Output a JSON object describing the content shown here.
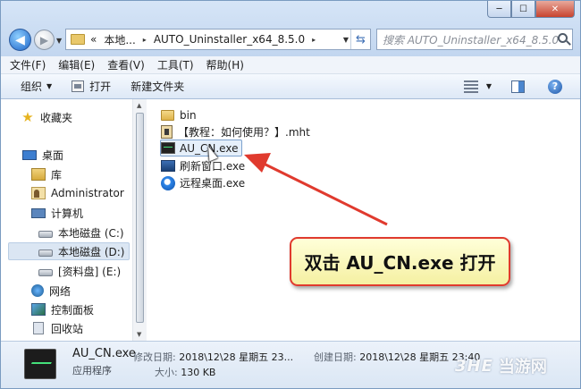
{
  "window": {
    "caption_min": "─",
    "caption_max": "☐",
    "caption_close": "✕"
  },
  "address": {
    "chevron": "«",
    "parts": [
      "本地...",
      "AUTO_Uninstaller_x64_8.5.0"
    ],
    "separator": "▸"
  },
  "search": {
    "placeholder": "搜索 AUTO_Uninstaller_x64_8.5.0"
  },
  "menu": [
    "文件(F)",
    "编辑(E)",
    "查看(V)",
    "工具(T)",
    "帮助(H)"
  ],
  "toolbar": {
    "organize": "组织",
    "open": "打开",
    "new_folder": "新建文件夹",
    "help": "?"
  },
  "nav": {
    "favorites": "收藏夹",
    "desktop": "桌面",
    "library": "库",
    "user": "Administrator",
    "computer": "计算机",
    "drive_c": "本地磁盘 (C:)",
    "drive_d": "本地磁盘 (D:)",
    "drive_e": "[资料盘] (E:)",
    "network": "网络",
    "control_panel": "控制面板",
    "recycle_bin": "回收站"
  },
  "files": [
    {
      "name": "bin",
      "icon": "folder-icon"
    },
    {
      "name": "【教程：如何使用？】.mht",
      "icon": "mht-file-icon"
    },
    {
      "name": "AU_CN.exe",
      "icon": "exe-file-icon",
      "selected": true
    },
    {
      "name": "刷新窗口.exe",
      "icon": "refresh-app-icon"
    },
    {
      "name": "远程桌面.exe",
      "icon": "remote-desktop-icon"
    }
  ],
  "callout": {
    "text": "双击 AU_CN.exe 打开"
  },
  "details": {
    "name": "AU_CN.exe",
    "type": "应用程序",
    "modified_label": "修改日期:",
    "modified_value": "2018\\12\\28 星期五 23...",
    "created_label": "创建日期:",
    "created_value": "2018\\12\\28 星期五 23:40",
    "size_label": "大小:",
    "size_value": "130 KB"
  },
  "watermark": {
    "logo": "3HE",
    "text": "当游网"
  },
  "colors": {
    "arrow": "#e03a2e",
    "callout_bg": "#fbf7b6",
    "selection": "#e5effa"
  }
}
